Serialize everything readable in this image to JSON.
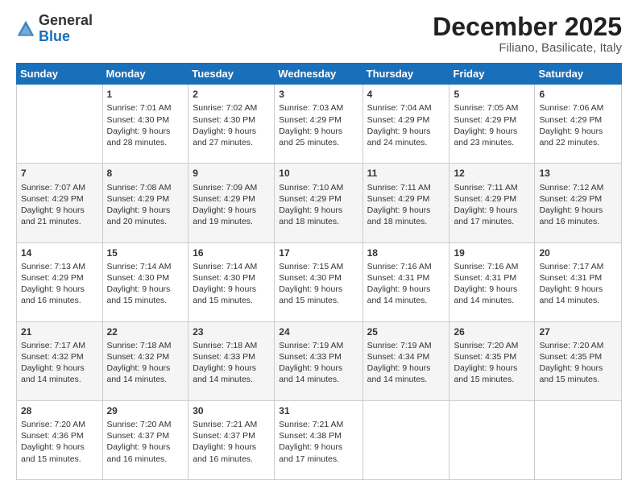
{
  "logo": {
    "general": "General",
    "blue": "Blue"
  },
  "title": "December 2025",
  "location": "Filiano, Basilicate, Italy",
  "headers": [
    "Sunday",
    "Monday",
    "Tuesday",
    "Wednesday",
    "Thursday",
    "Friday",
    "Saturday"
  ],
  "weeks": [
    [
      {
        "day": "",
        "sunrise": "",
        "sunset": "",
        "daylight": ""
      },
      {
        "day": "1",
        "sunrise": "Sunrise: 7:01 AM",
        "sunset": "Sunset: 4:30 PM",
        "daylight": "Daylight: 9 hours and 28 minutes."
      },
      {
        "day": "2",
        "sunrise": "Sunrise: 7:02 AM",
        "sunset": "Sunset: 4:30 PM",
        "daylight": "Daylight: 9 hours and 27 minutes."
      },
      {
        "day": "3",
        "sunrise": "Sunrise: 7:03 AM",
        "sunset": "Sunset: 4:29 PM",
        "daylight": "Daylight: 9 hours and 25 minutes."
      },
      {
        "day": "4",
        "sunrise": "Sunrise: 7:04 AM",
        "sunset": "Sunset: 4:29 PM",
        "daylight": "Daylight: 9 hours and 24 minutes."
      },
      {
        "day": "5",
        "sunrise": "Sunrise: 7:05 AM",
        "sunset": "Sunset: 4:29 PM",
        "daylight": "Daylight: 9 hours and 23 minutes."
      },
      {
        "day": "6",
        "sunrise": "Sunrise: 7:06 AM",
        "sunset": "Sunset: 4:29 PM",
        "daylight": "Daylight: 9 hours and 22 minutes."
      }
    ],
    [
      {
        "day": "7",
        "sunrise": "Sunrise: 7:07 AM",
        "sunset": "Sunset: 4:29 PM",
        "daylight": "Daylight: 9 hours and 21 minutes."
      },
      {
        "day": "8",
        "sunrise": "Sunrise: 7:08 AM",
        "sunset": "Sunset: 4:29 PM",
        "daylight": "Daylight: 9 hours and 20 minutes."
      },
      {
        "day": "9",
        "sunrise": "Sunrise: 7:09 AM",
        "sunset": "Sunset: 4:29 PM",
        "daylight": "Daylight: 9 hours and 19 minutes."
      },
      {
        "day": "10",
        "sunrise": "Sunrise: 7:10 AM",
        "sunset": "Sunset: 4:29 PM",
        "daylight": "Daylight: 9 hours and 18 minutes."
      },
      {
        "day": "11",
        "sunrise": "Sunrise: 7:11 AM",
        "sunset": "Sunset: 4:29 PM",
        "daylight": "Daylight: 9 hours and 18 minutes."
      },
      {
        "day": "12",
        "sunrise": "Sunrise: 7:11 AM",
        "sunset": "Sunset: 4:29 PM",
        "daylight": "Daylight: 9 hours and 17 minutes."
      },
      {
        "day": "13",
        "sunrise": "Sunrise: 7:12 AM",
        "sunset": "Sunset: 4:29 PM",
        "daylight": "Daylight: 9 hours and 16 minutes."
      }
    ],
    [
      {
        "day": "14",
        "sunrise": "Sunrise: 7:13 AM",
        "sunset": "Sunset: 4:29 PM",
        "daylight": "Daylight: 9 hours and 16 minutes."
      },
      {
        "day": "15",
        "sunrise": "Sunrise: 7:14 AM",
        "sunset": "Sunset: 4:30 PM",
        "daylight": "Daylight: 9 hours and 15 minutes."
      },
      {
        "day": "16",
        "sunrise": "Sunrise: 7:14 AM",
        "sunset": "Sunset: 4:30 PM",
        "daylight": "Daylight: 9 hours and 15 minutes."
      },
      {
        "day": "17",
        "sunrise": "Sunrise: 7:15 AM",
        "sunset": "Sunset: 4:30 PM",
        "daylight": "Daylight: 9 hours and 15 minutes."
      },
      {
        "day": "18",
        "sunrise": "Sunrise: 7:16 AM",
        "sunset": "Sunset: 4:31 PM",
        "daylight": "Daylight: 9 hours and 14 minutes."
      },
      {
        "day": "19",
        "sunrise": "Sunrise: 7:16 AM",
        "sunset": "Sunset: 4:31 PM",
        "daylight": "Daylight: 9 hours and 14 minutes."
      },
      {
        "day": "20",
        "sunrise": "Sunrise: 7:17 AM",
        "sunset": "Sunset: 4:31 PM",
        "daylight": "Daylight: 9 hours and 14 minutes."
      }
    ],
    [
      {
        "day": "21",
        "sunrise": "Sunrise: 7:17 AM",
        "sunset": "Sunset: 4:32 PM",
        "daylight": "Daylight: 9 hours and 14 minutes."
      },
      {
        "day": "22",
        "sunrise": "Sunrise: 7:18 AM",
        "sunset": "Sunset: 4:32 PM",
        "daylight": "Daylight: 9 hours and 14 minutes."
      },
      {
        "day": "23",
        "sunrise": "Sunrise: 7:18 AM",
        "sunset": "Sunset: 4:33 PM",
        "daylight": "Daylight: 9 hours and 14 minutes."
      },
      {
        "day": "24",
        "sunrise": "Sunrise: 7:19 AM",
        "sunset": "Sunset: 4:33 PM",
        "daylight": "Daylight: 9 hours and 14 minutes."
      },
      {
        "day": "25",
        "sunrise": "Sunrise: 7:19 AM",
        "sunset": "Sunset: 4:34 PM",
        "daylight": "Daylight: 9 hours and 14 minutes."
      },
      {
        "day": "26",
        "sunrise": "Sunrise: 7:20 AM",
        "sunset": "Sunset: 4:35 PM",
        "daylight": "Daylight: 9 hours and 15 minutes."
      },
      {
        "day": "27",
        "sunrise": "Sunrise: 7:20 AM",
        "sunset": "Sunset: 4:35 PM",
        "daylight": "Daylight: 9 hours and 15 minutes."
      }
    ],
    [
      {
        "day": "28",
        "sunrise": "Sunrise: 7:20 AM",
        "sunset": "Sunset: 4:36 PM",
        "daylight": "Daylight: 9 hours and 15 minutes."
      },
      {
        "day": "29",
        "sunrise": "Sunrise: 7:20 AM",
        "sunset": "Sunset: 4:37 PM",
        "daylight": "Daylight: 9 hours and 16 minutes."
      },
      {
        "day": "30",
        "sunrise": "Sunrise: 7:21 AM",
        "sunset": "Sunset: 4:37 PM",
        "daylight": "Daylight: 9 hours and 16 minutes."
      },
      {
        "day": "31",
        "sunrise": "Sunrise: 7:21 AM",
        "sunset": "Sunset: 4:38 PM",
        "daylight": "Daylight: 9 hours and 17 minutes."
      },
      {
        "day": "",
        "sunrise": "",
        "sunset": "",
        "daylight": ""
      },
      {
        "day": "",
        "sunrise": "",
        "sunset": "",
        "daylight": ""
      },
      {
        "day": "",
        "sunrise": "",
        "sunset": "",
        "daylight": ""
      }
    ]
  ]
}
